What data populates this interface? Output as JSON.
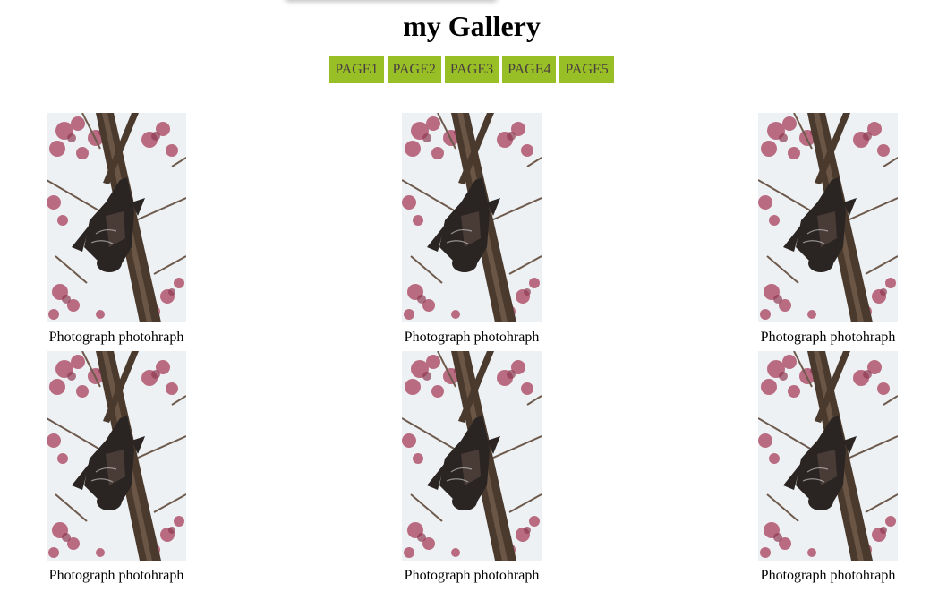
{
  "header": {
    "title": "my Gallery"
  },
  "nav": {
    "items": [
      {
        "label": "PAGE1"
      },
      {
        "label": "PAGE2"
      },
      {
        "label": "PAGE3"
      },
      {
        "label": "PAGE4"
      },
      {
        "label": "PAGE5"
      }
    ],
    "accent_color": "#99bf26"
  },
  "gallery": {
    "items": [
      {
        "caption": "Photograph photohraph",
        "image": "bat-hanging-on-branch-photo"
      },
      {
        "caption": "Photograph photohraph",
        "image": "bat-hanging-on-branch-photo"
      },
      {
        "caption": "Photograph photohraph",
        "image": "bat-hanging-on-branch-photo"
      },
      {
        "caption": "Photograph photohraph",
        "image": "bat-hanging-on-branch-photo"
      },
      {
        "caption": "Photograph photohraph",
        "image": "bat-hanging-on-branch-photo"
      },
      {
        "caption": "Photograph photohraph",
        "image": "bat-hanging-on-branch-photo"
      }
    ]
  }
}
